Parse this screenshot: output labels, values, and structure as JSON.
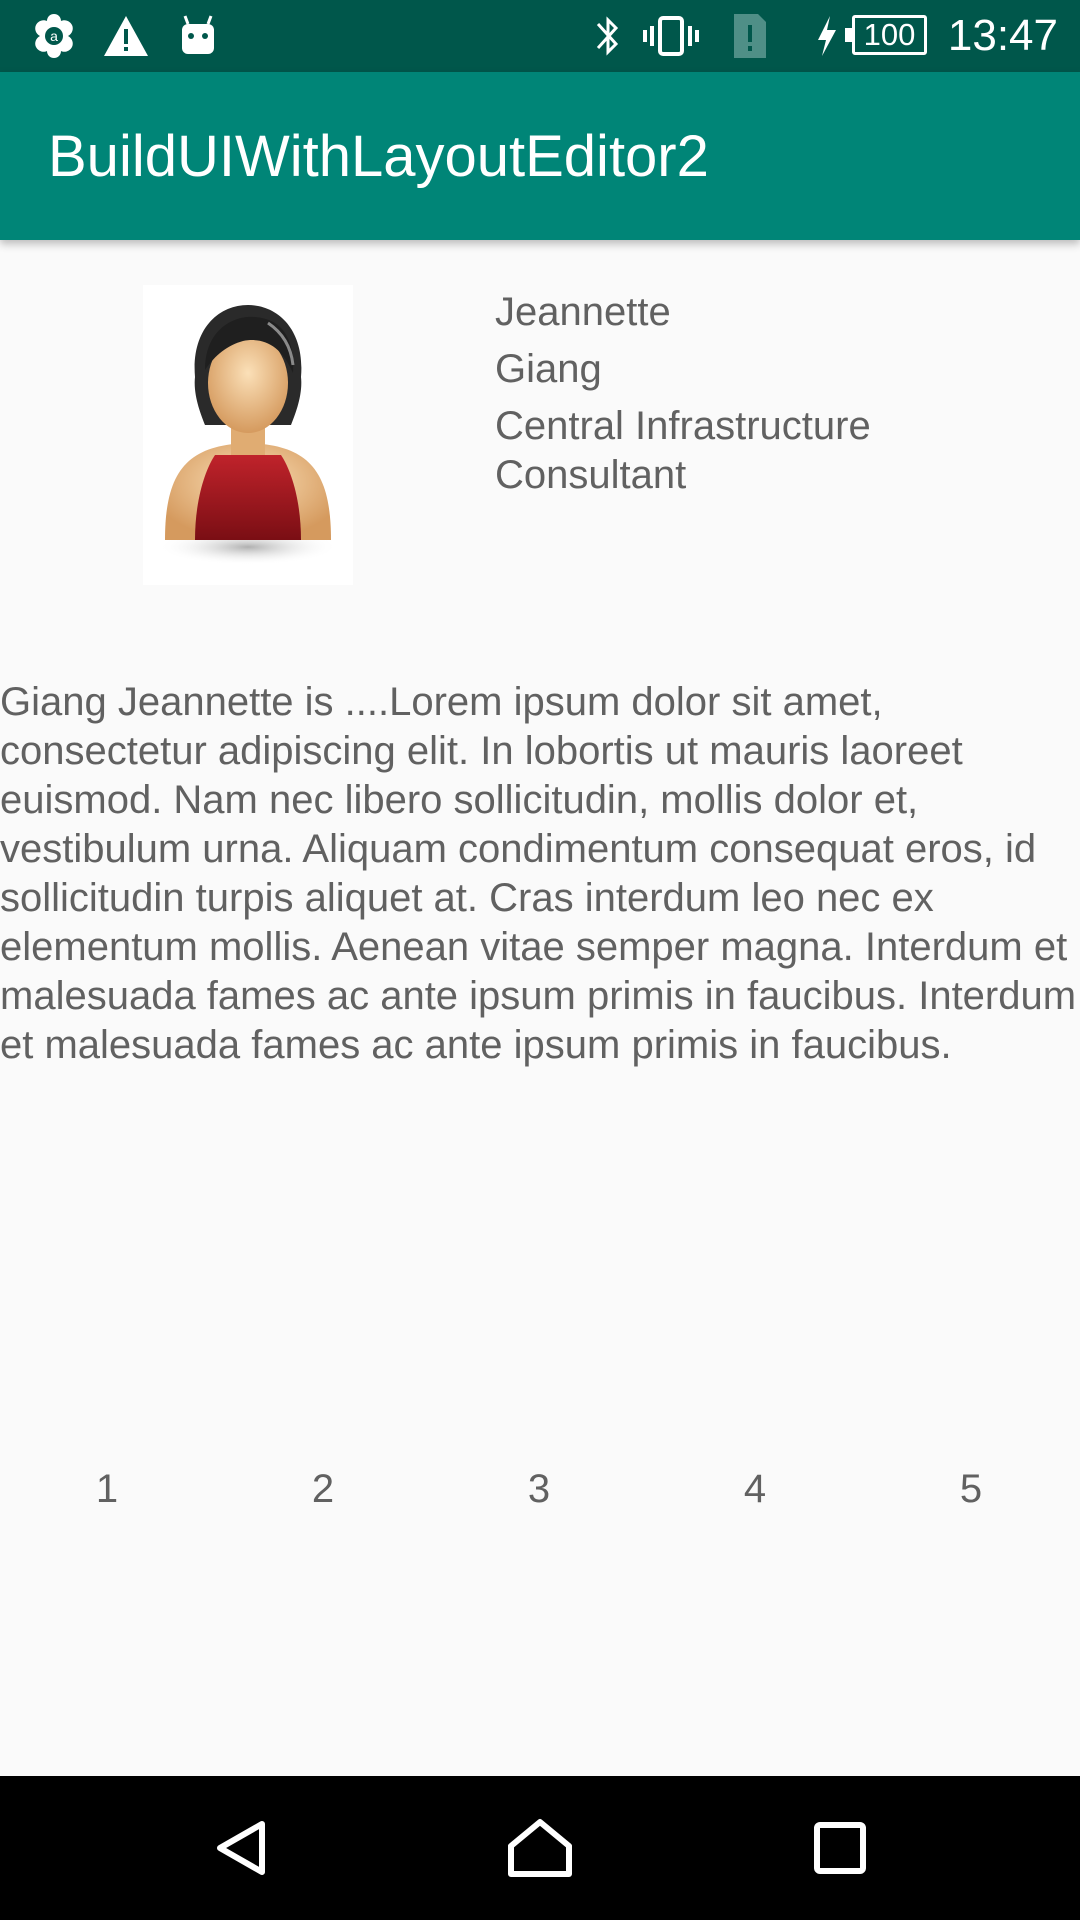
{
  "status_bar": {
    "time": "13:47",
    "battery_level": "100",
    "icons": [
      "app-notification-icon",
      "warning-icon",
      "android-debug-icon",
      "bluetooth-icon",
      "vibrate-icon",
      "sim-alert-icon",
      "charging-icon",
      "battery-icon"
    ]
  },
  "app_bar": {
    "title": "BuildUIWithLayoutEditor2",
    "color": "#008577",
    "status_color": "#00574b"
  },
  "profile": {
    "avatar": "female-user-avatar",
    "first_name": "Jeannette",
    "last_name": "Giang",
    "title_line1": "Central Infrastructure",
    "title_line2": "Consultant"
  },
  "bio": "Giang Jeannette is ....Lorem ipsum dolor sit amet, consectetur adipiscing elit. In lobortis ut mauris laoreet euismod. Nam nec libero sollicitudin, mollis dolor et, vestibulum urna. Aliquam condimentum consequat eros, id sollicitudin turpis aliquet at. Cras interdum leo nec ex elementum mollis. Aenean vitae semper magna. Interdum et malesuada fames ac ante ipsum primis in faucibus. Interdum et malesuada fames ac ante ipsum primis in faucibus.",
  "numbers": [
    "1",
    "2",
    "3",
    "4",
    "5"
  ],
  "nav_bar": {
    "icons": [
      "back-icon",
      "home-icon",
      "recents-icon"
    ]
  }
}
